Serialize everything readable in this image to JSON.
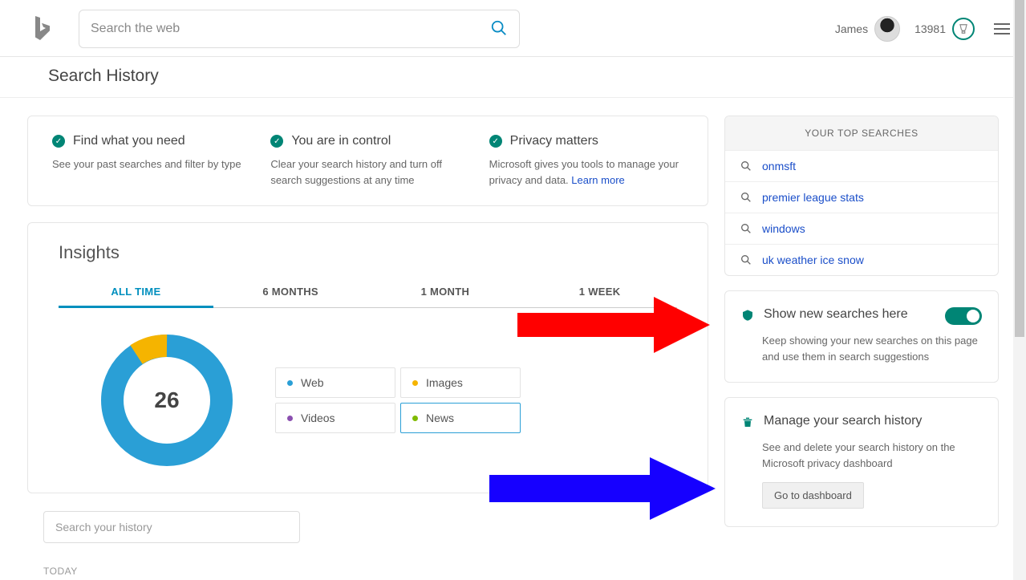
{
  "header": {
    "search_placeholder": "Search the web",
    "user_name": "James",
    "points": "13981"
  },
  "page_title": "Search History",
  "info": [
    {
      "title": "Find what you need",
      "desc": "See your past searches and filter by type"
    },
    {
      "title": "You are in control",
      "desc": "Clear your search history and turn off search suggestions at any time"
    },
    {
      "title": "Privacy matters",
      "desc": "Microsoft gives you tools to manage your privacy and data. ",
      "link": "Learn more"
    }
  ],
  "insights": {
    "title": "Insights",
    "tabs": [
      "ALL TIME",
      "6 MONTHS",
      "1 MONTH",
      "1 WEEK"
    ],
    "total": "26",
    "legend": [
      {
        "label": "Web",
        "color": "#2a9fd6"
      },
      {
        "label": "Images",
        "color": "#f5b400"
      },
      {
        "label": "Videos",
        "color": "#8b4fb0"
      },
      {
        "label": "News",
        "color": "#7fba00"
      }
    ]
  },
  "history_search_placeholder": "Search your history",
  "today_label": "TODAY",
  "top_searches": {
    "title": "YOUR TOP SEARCHES",
    "items": [
      "onmsft",
      "premier league stats",
      "windows",
      "uk weather ice snow"
    ]
  },
  "show_new": {
    "title": "Show new searches here",
    "desc": "Keep showing your new searches on this page and use them in search suggestions"
  },
  "manage": {
    "title": "Manage your search history",
    "desc": "See and delete your search history on the Microsoft privacy dashboard",
    "button": "Go to dashboard"
  },
  "chart_data": {
    "type": "donut",
    "total": 26,
    "series": [
      {
        "name": "Web",
        "value": 24,
        "color": "#2a9fd6"
      },
      {
        "name": "Images",
        "value": 2,
        "color": "#f5b400"
      },
      {
        "name": "Videos",
        "value": 0,
        "color": "#8b4fb0"
      },
      {
        "name": "News",
        "value": 0,
        "color": "#7fba00"
      }
    ]
  }
}
